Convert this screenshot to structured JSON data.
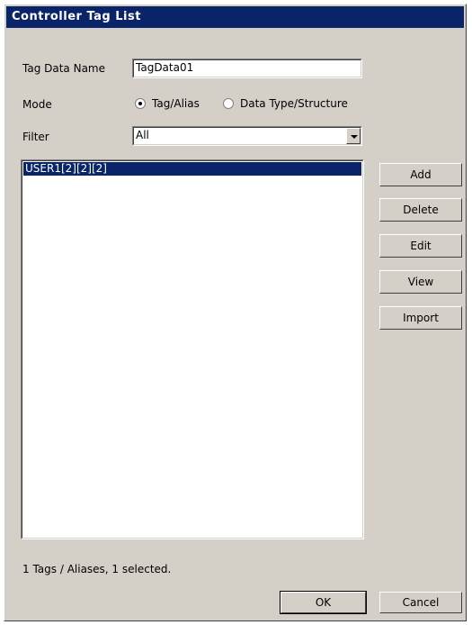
{
  "window": {
    "title": "Controller Tag List"
  },
  "tag_data_name": {
    "label": "Tag Data Name",
    "value": "TagData01"
  },
  "mode": {
    "label": "Mode",
    "options": [
      "Tag/Alias",
      "Data Type/Structure"
    ],
    "selected": "Tag/Alias"
  },
  "filter": {
    "label": "Filter",
    "value": "All"
  },
  "tag_list": {
    "items": [
      "USER1[2][2][2]"
    ],
    "selected_item": "USER1[2][2][2]"
  },
  "actions": {
    "add": "Add",
    "delete": "Delete",
    "edit": "Edit",
    "view": "View",
    "import": "Import"
  },
  "status": "1 Tags / Aliases, 1 selected.",
  "footer": {
    "ok": "OK",
    "cancel": "Cancel"
  },
  "colors": {
    "title_bar": "#0a246a",
    "window_bg": "#d4d0c8",
    "selection": "#0a246a"
  }
}
